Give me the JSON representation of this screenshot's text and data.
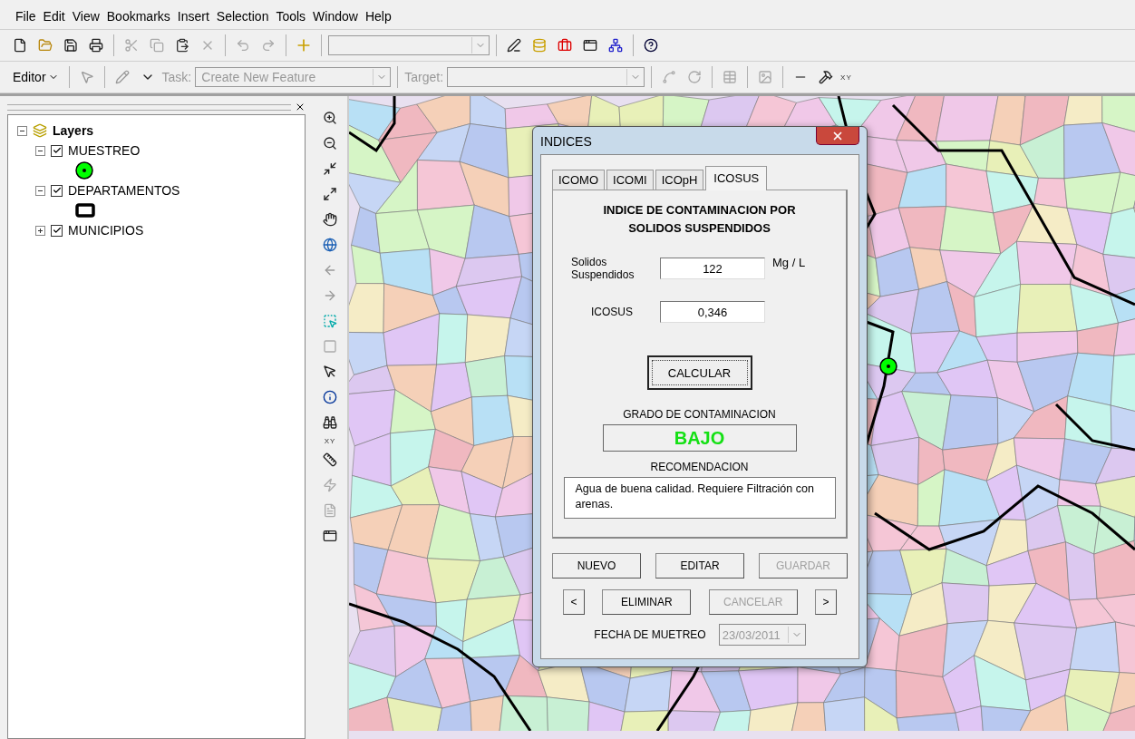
{
  "menu": [
    "File",
    "Edit",
    "View",
    "Bookmarks",
    "Insert",
    "Selection",
    "Tools",
    "Window",
    "Help"
  ],
  "editor_toolbar": {
    "editor_menu": "Editor",
    "task_label": "Task:",
    "task_value": "Create New Feature",
    "target_label": "Target:",
    "xy_label": "XY"
  },
  "toc": {
    "title": "Layers",
    "expanded": true,
    "layers": [
      {
        "name": "MUESTREO",
        "checked": true,
        "expanded": true,
        "kind": "point"
      },
      {
        "name": "DEPARTAMENTOS",
        "checked": true,
        "expanded": true,
        "kind": "outline"
      },
      {
        "name": "MUNICIPIOS",
        "checked": true,
        "expanded": false
      }
    ]
  },
  "tools": {
    "xy_label": "XY"
  },
  "dialog": {
    "title": "INDICES",
    "tabs": [
      {
        "label": "ICOMO",
        "selected": false
      },
      {
        "label": "ICOMI",
        "selected": false
      },
      {
        "label": "ICOpH",
        "selected": false
      },
      {
        "label": "ICOSUS",
        "selected": true
      }
    ],
    "heading": [
      "INDICE DE CONTAMINACION POR",
      "SOLIDOS SUSPENDIDOS"
    ],
    "fields": [
      {
        "label": "Solidos Suspendidos",
        "value": "122",
        "unit": "Mg / L"
      },
      {
        "label": "ICOSUS",
        "value": "0,346"
      }
    ],
    "calculate": "CALCULAR",
    "grade_label": "GRADO DE CONTAMINACION",
    "grade_value": "BAJO",
    "recommendation_label": "RECOMENDACION",
    "recommendation": "Agua de buena calidad. Requiere Filtración con arenas.",
    "buttons": [
      {
        "label": "NUEVO",
        "disabled": false
      },
      {
        "label": "EDITAR",
        "disabled": false
      },
      {
        "label": "GUARDAR",
        "disabled": true
      }
    ],
    "prev": "<",
    "next": ">",
    "nav_buttons": [
      {
        "label": "ELIMINAR",
        "disabled": false
      },
      {
        "label": "CANCELAR",
        "disabled": true
      }
    ],
    "date_label": "FECHA DE MUETREO",
    "date_value": "23/03/2011",
    "date_disabled": true
  }
}
